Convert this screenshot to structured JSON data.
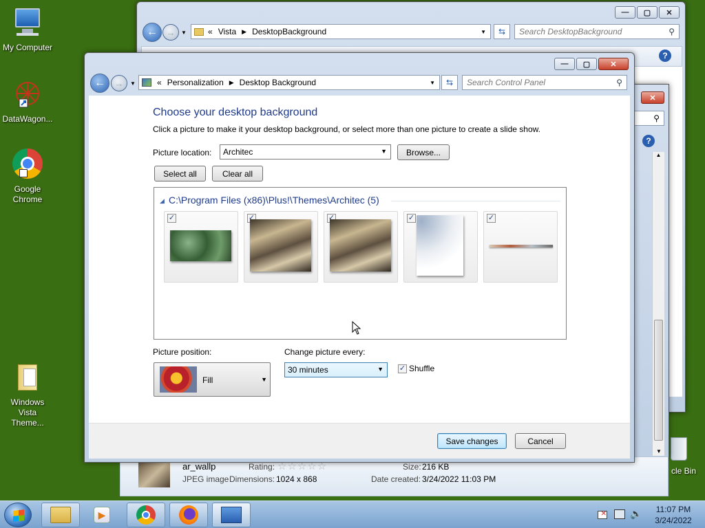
{
  "desktop": {
    "icons": [
      {
        "label": "My Computer"
      },
      {
        "label": "DataWagon..."
      },
      {
        "label": "Google Chrome"
      },
      {
        "label": "Windows Vista Theme..."
      },
      {
        "label": "cle Bin"
      }
    ]
  },
  "explorer_window": {
    "address": {
      "prefix": "«",
      "parts": [
        "Vista",
        "DesktopBackground"
      ]
    },
    "search_placeholder": "Search DesktopBackground",
    "details": {
      "filename": "ar_wallp",
      "type": "JPEG image",
      "rating_label": "Rating:",
      "dimensions_label": "Dimensions:",
      "dimensions_value": "1024 x 868",
      "size_label": "Size:",
      "size_value": "216 KB",
      "date_label": "Date created:",
      "date_value": "3/24/2022 11:03 PM"
    }
  },
  "control_panel": {
    "address": {
      "prefix": "«",
      "parts": [
        "Personalization",
        "Desktop Background"
      ]
    },
    "search_placeholder": "Search Control Panel",
    "heading": "Choose your desktop background",
    "subtext": "Click a picture to make it your desktop background, or select more than one picture to create a slide show.",
    "picture_location_label": "Picture location:",
    "picture_location_value": "Architec",
    "browse_label": "Browse...",
    "select_all_label": "Select all",
    "clear_all_label": "Clear all",
    "group_header": "C:\\Program Files (x86)\\Plus!\\Themes\\Architec (5)",
    "pictures_checked": [
      true,
      true,
      true,
      true,
      true
    ],
    "picture_position_label": "Picture position:",
    "picture_position_value": "Fill",
    "change_every_label": "Change picture every:",
    "change_every_value": "30 minutes",
    "shuffle_label": "Shuffle",
    "shuffle_checked": true,
    "save_label": "Save changes",
    "cancel_label": "Cancel"
  },
  "taskbar": {
    "time": "11:07 PM",
    "date": "3/24/2022"
  }
}
